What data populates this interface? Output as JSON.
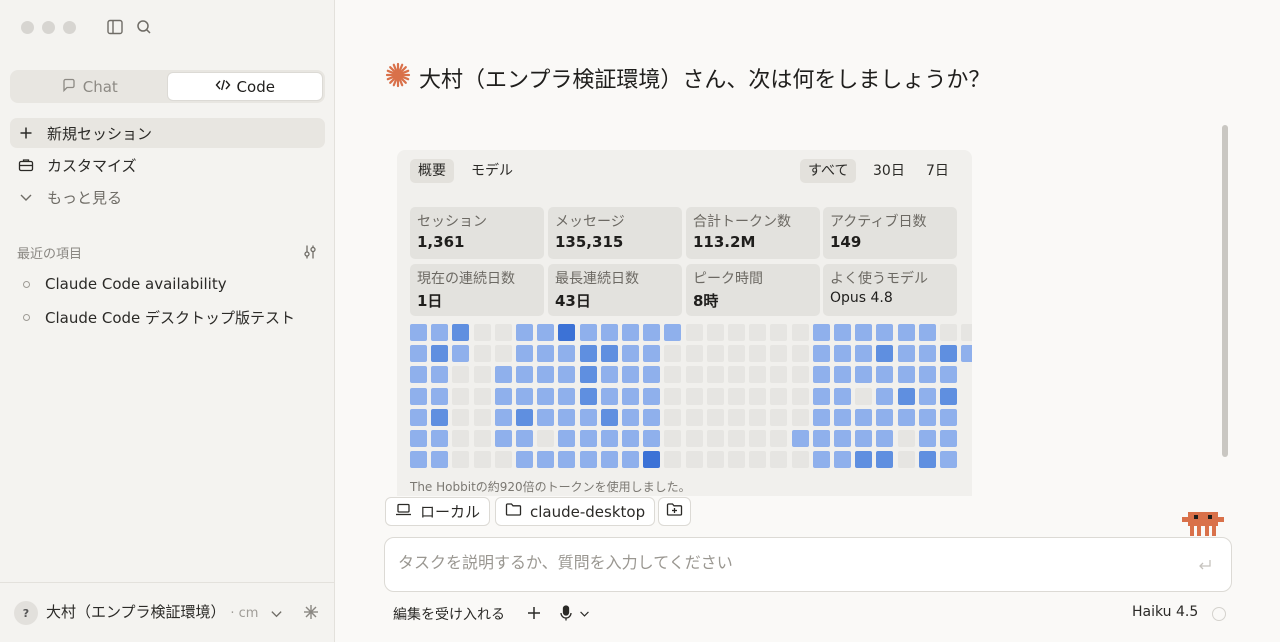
{
  "sidebar": {
    "mode_tabs": [
      {
        "label": "Chat",
        "icon": "chat-bubble-icon",
        "active": false
      },
      {
        "label": "Code",
        "icon": "code-icon",
        "active": true
      }
    ],
    "nav": {
      "new_session": "新規セッション",
      "customize": "カスタマイズ",
      "more": "もっと見る"
    },
    "recent_label": "最近の項目",
    "recent_items": [
      "Claude Code availability",
      "Claude Code デスクトップ版テスト"
    ],
    "footer": {
      "avatar": "?",
      "user_name": "大村（エンプラ検証環境）",
      "user_sub": "· cm"
    }
  },
  "main": {
    "greeting": "大村（エンプラ検証環境）さん、次は何をしましょうか？",
    "stats": {
      "tabs_left": [
        "概要",
        "モデル"
      ],
      "tabs_right": [
        "すべて",
        "30日",
        "7日"
      ],
      "cards": [
        {
          "label": "セッション",
          "value": "1,361"
        },
        {
          "label": "メッセージ",
          "value": "135,315"
        },
        {
          "label": "合計トークン数",
          "value": "113.2M"
        },
        {
          "label": "アクティブ日数",
          "value": "149"
        },
        {
          "label": "現在の連続日数",
          "value": "1日"
        },
        {
          "label": "最長連続日数",
          "value": "43日"
        },
        {
          "label": "ピーク時間",
          "value": "8時"
        },
        {
          "label": "よく使うモデル",
          "value": "Opus 4.8"
        }
      ],
      "heatmap_levels": [
        [
          2,
          2,
          3,
          0,
          0,
          2,
          2,
          4,
          2,
          2,
          2,
          2,
          2,
          0,
          0,
          0,
          0,
          0,
          0,
          2,
          2,
          2,
          2,
          2,
          2,
          0,
          0
        ],
        [
          2,
          3,
          2,
          0,
          0,
          2,
          2,
          2,
          3,
          3,
          2,
          2,
          0,
          0,
          0,
          0,
          0,
          0,
          0,
          2,
          2,
          2,
          3,
          2,
          2,
          3,
          2
        ],
        [
          2,
          2,
          0,
          0,
          2,
          2,
          2,
          2,
          3,
          2,
          2,
          2,
          0,
          0,
          0,
          0,
          0,
          0,
          0,
          2,
          2,
          2,
          2,
          2,
          2,
          2,
          -1
        ],
        [
          2,
          2,
          0,
          0,
          2,
          2,
          2,
          2,
          3,
          2,
          2,
          2,
          0,
          0,
          0,
          0,
          0,
          0,
          0,
          2,
          2,
          0,
          2,
          3,
          2,
          3,
          -1
        ],
        [
          2,
          3,
          0,
          0,
          2,
          3,
          2,
          2,
          2,
          3,
          2,
          2,
          0,
          0,
          0,
          0,
          0,
          0,
          0,
          2,
          2,
          2,
          2,
          2,
          2,
          2,
          -1
        ],
        [
          2,
          2,
          0,
          0,
          2,
          2,
          0,
          2,
          2,
          2,
          2,
          2,
          0,
          0,
          0,
          0,
          0,
          0,
          2,
          2,
          2,
          2,
          2,
          0,
          2,
          2,
          -1
        ],
        [
          2,
          2,
          0,
          0,
          0,
          2,
          2,
          2,
          2,
          2,
          2,
          4,
          0,
          0,
          0,
          0,
          0,
          0,
          0,
          2,
          2,
          3,
          3,
          0,
          3,
          2,
          -1
        ]
      ],
      "heatmap_colors": [
        "#e6e5e2",
        "#b9cdf0",
        "#8fb0ec",
        "#5f8fe0",
        "#3c72d6"
      ],
      "note": "The Hobbitの約920倍のトークンを使用しました。"
    },
    "chips": [
      {
        "label": "ローカル",
        "icon": "laptop-icon"
      },
      {
        "label": "claude-desktop",
        "icon": "folder-icon"
      }
    ],
    "input_placeholder": "タスクを説明するか、質問を入力してください",
    "bottom": {
      "accept_edits": "編集を受け入れる",
      "model": "Haiku 4.5"
    },
    "accent_color": "#d9714a"
  }
}
